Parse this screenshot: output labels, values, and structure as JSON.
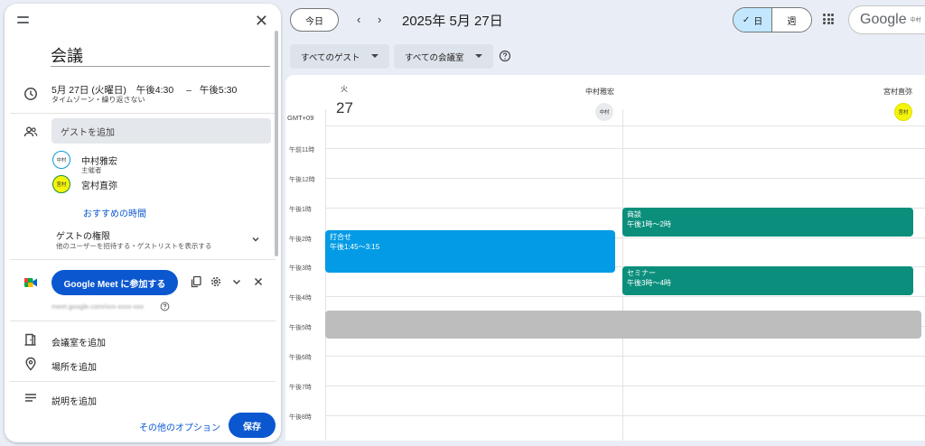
{
  "panel": {
    "title": "会議",
    "datetime": {
      "date": "5月 27日 (火曜日)",
      "start": "午後4:30",
      "dash": "–",
      "end": "午後5:30",
      "repeat": "タイムゾーン・繰り返さない"
    },
    "guests": {
      "placeholder": "ゲストを追加",
      "list": [
        {
          "avatar": "中村",
          "name": "中村雅宏",
          "role": "主催者"
        },
        {
          "avatar": "宮村",
          "name": "宮村直弥",
          "role": ""
        }
      ],
      "suggested_times": "おすすめの時間",
      "permissions_title": "ゲストの権限",
      "permissions_sub": "他のユーザーを招待する・ゲストリストを表示する"
    },
    "meet": {
      "button": "Google Meet に参加する",
      "link": "meet.google.com/xxx-xxxx-xxx"
    },
    "options": {
      "room": "会議室を追加",
      "location": "場所を追加",
      "description": "説明を追加"
    },
    "footer": {
      "more_options": "その他のオプション",
      "save": "保存"
    }
  },
  "toolbar": {
    "today": "今日",
    "prev": "‹",
    "next": "›",
    "date_title": "2025年 5月 27日",
    "view_day": "日",
    "view_week": "週",
    "google": "Google",
    "account_badge": "中村"
  },
  "filters": {
    "guests": "すべてのゲスト",
    "rooms": "すべての会議室"
  },
  "calendar": {
    "dow": "火",
    "day": "27",
    "timezone": "GMT+09",
    "columns": [
      {
        "name": "中村雅宏",
        "avatar": "中村"
      },
      {
        "name": "宮村直弥",
        "avatar": "宮村"
      }
    ],
    "hours": [
      "午前11時",
      "午後12時",
      "午後1時",
      "午後2時",
      "午後3時",
      "午後4時",
      "午後5時",
      "午後6時",
      "午後7時",
      "午後8時"
    ],
    "events": [
      {
        "title": "打合せ",
        "time": "午後1:45～3:15",
        "color": "#039be5"
      },
      {
        "title": "商談",
        "time": "午後1時～2時",
        "color": "#0b8f7c"
      },
      {
        "title": "セミナー",
        "time": "午後3時～4時",
        "color": "#0b8f7c"
      }
    ]
  }
}
